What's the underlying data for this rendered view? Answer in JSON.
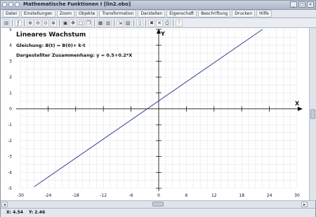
{
  "window": {
    "title": "Mathematische Funktionen I [lin2.obo]",
    "controls": [
      "_",
      "□",
      "×"
    ]
  },
  "menu": {
    "items": [
      "Datei",
      "Einstellungen",
      "Zoom",
      "Objekte",
      "Transformation",
      "Darstellen",
      "Eigenschaft",
      "Beschriftung",
      "Drucken",
      "Hilfe"
    ]
  },
  "toolbar": {
    "icons": [
      "calculator-icon",
      "function-icon",
      "zoom-in-icon",
      "zoom-out-icon",
      "zoom-fit-icon",
      "zoom-window-icon",
      "frame-icon",
      "move-icon",
      "rectangle-icon",
      "copy-icon",
      "grid-icon",
      "grid2-icon",
      "align-icon",
      "paste-icon",
      "page-icon",
      "delete-icon",
      "close-icon",
      "print-icon",
      "help-icon"
    ]
  },
  "annotations": {
    "heading": "Lineares Wachstum",
    "equation": "Gleichung: B(t) = B(0)+ k·t",
    "relation": "Dargestellter Zusammenhang: y = 0.5+0.2*X"
  },
  "chart_data": {
    "type": "line",
    "title": "Lineares Wachstum",
    "xlabel": "X",
    "ylabel": "Y",
    "xlim": [
      -30,
      30
    ],
    "ylim": [
      -5,
      5
    ],
    "grid": true,
    "x_ticks": [
      "-30",
      "-24",
      "-18",
      "-12",
      "-6",
      "0",
      "6",
      "12",
      "18",
      "24",
      "30"
    ],
    "y_ticks": [
      "-5",
      "-4",
      "-3",
      "-2",
      "-1",
      "0",
      "1",
      "2",
      "3",
      "4",
      "5"
    ],
    "series": [
      {
        "x": [
          -27,
          22.5
        ],
        "y": [
          -4.9,
          5.0
        ]
      }
    ],
    "line_color": "#3a3f8f"
  },
  "status": {
    "x": "X: 4.54",
    "y": "Y: 2.46"
  }
}
